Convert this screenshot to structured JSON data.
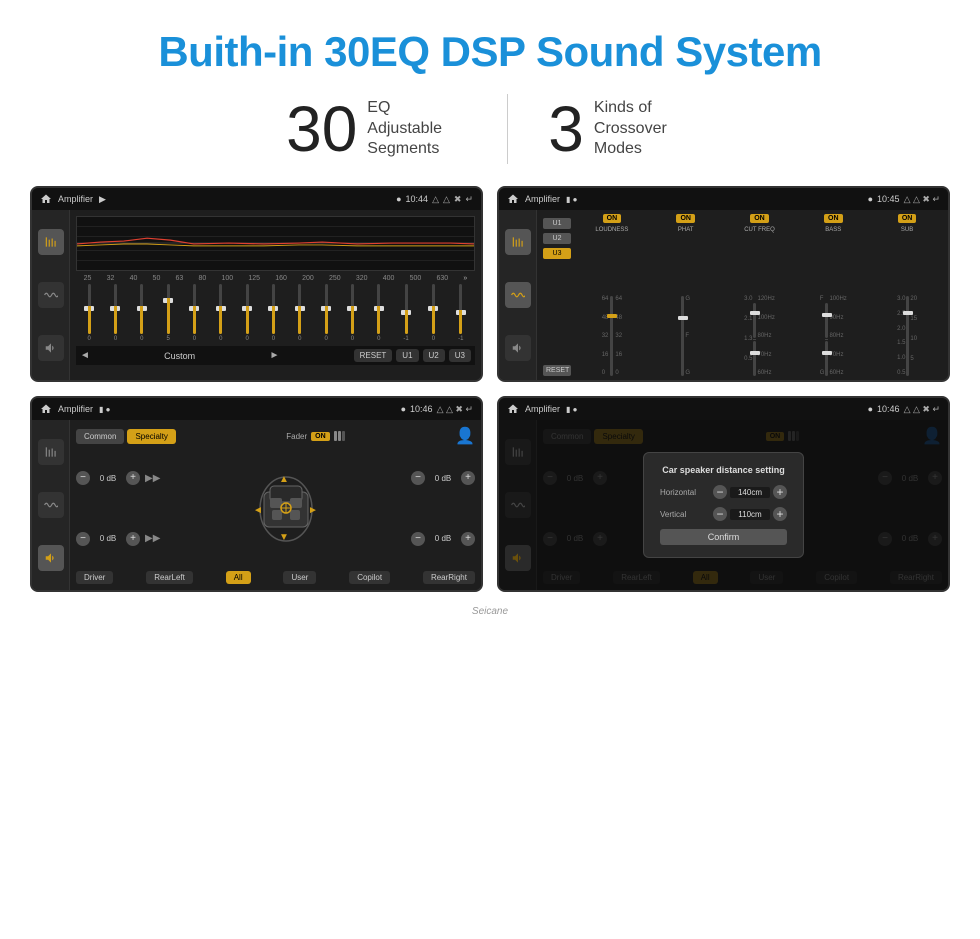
{
  "page": {
    "title": "Buith-in 30EQ DSP Sound System",
    "stat1_number": "30",
    "stat1_label": "EQ Adjustable\nSegments",
    "stat2_number": "3",
    "stat2_label": "Kinds of\nCrossover Modes"
  },
  "screen1": {
    "label": "Amplifier",
    "time": "10:44",
    "freq_labels": [
      "25",
      "32",
      "40",
      "50",
      "63",
      "80",
      "100",
      "125",
      "160",
      "200",
      "250",
      "320",
      "400",
      "500",
      "630"
    ],
    "eq_values": [
      "0",
      "0",
      "0",
      "5",
      "0",
      "0",
      "0",
      "0",
      "0",
      "0",
      "0",
      "0",
      "-1",
      "0",
      "-1"
    ],
    "bottom_buttons": [
      "RESET",
      "U1",
      "U2",
      "U3"
    ],
    "nav_left": "◄",
    "nav_label": "Custom",
    "nav_right": "►"
  },
  "screen2": {
    "label": "Amplifier",
    "time": "10:45",
    "presets": [
      "U1",
      "U2",
      "U3"
    ],
    "active_preset": "U3",
    "channels": [
      {
        "name": "LOUDNESS",
        "on": true
      },
      {
        "name": "PHAT",
        "on": true
      },
      {
        "name": "CUT FREQ",
        "on": true
      },
      {
        "name": "BASS",
        "on": true
      },
      {
        "name": "SUB",
        "on": true
      }
    ],
    "reset_label": "RESET"
  },
  "screen3": {
    "label": "Amplifier",
    "time": "10:46",
    "mode_btns": [
      "Common",
      "Specialty"
    ],
    "active_mode": "Specialty",
    "fader_label": "Fader",
    "fader_on": "ON",
    "bottom_buttons": [
      "Driver",
      "RearLeft",
      "All",
      "User",
      "Copilot",
      "RearRight"
    ],
    "active_bottom": "All",
    "db_values": [
      "0 dB",
      "0 dB",
      "0 dB",
      "0 dB"
    ]
  },
  "screen4": {
    "label": "Amplifier",
    "time": "10:46",
    "mode_btns": [
      "Common",
      "Specialty"
    ],
    "dialog": {
      "title": "Car speaker distance setting",
      "horizontal_label": "Horizontal",
      "horizontal_value": "140cm",
      "vertical_label": "Vertical",
      "vertical_value": "110cm",
      "confirm_label": "Confirm"
    },
    "db_values": [
      "0 dB",
      "0 dB"
    ],
    "bottom_buttons": [
      "Driver",
      "RearLeft",
      "All",
      "User",
      "Copilot",
      "RearRight"
    ]
  },
  "watermark": "Seicane"
}
